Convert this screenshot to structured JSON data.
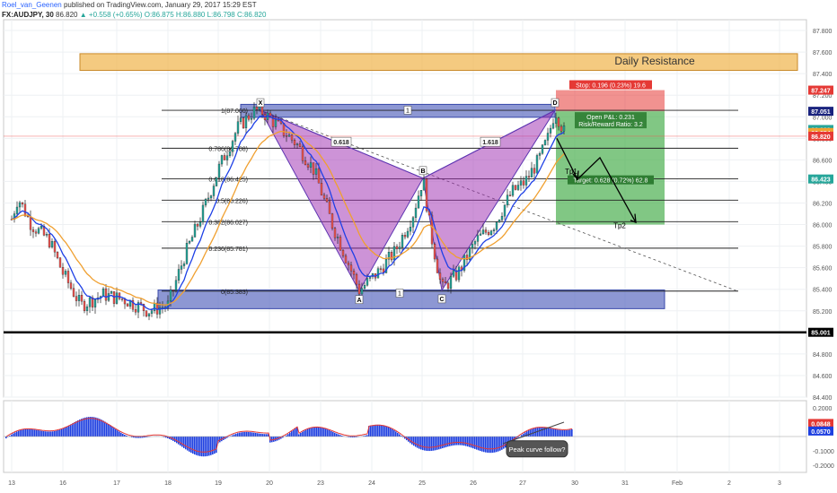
{
  "header": {
    "author": "Roel_van_Geenen",
    "published": "published on TradingView.com, January 29, 2017 15:29 EST",
    "symbol": "FX:AUDJPY, 30",
    "last": "86.820",
    "change_arrow": "▲",
    "change": "+0.558 (+0.65%)",
    "open": "O:86.875",
    "high": "H:86.880",
    "low": "L:86.798",
    "close": "C:86.820"
  },
  "colors": {
    "up": "#26a69a",
    "down": "#ef5350",
    "pattern": "#9c27b0",
    "zone": "#5c6bc0",
    "resistance": "#f0b34a",
    "target": "#4caf50",
    "stop": "#e53935",
    "ema_fast": "#1e40e6",
    "ema_slow": "#f0a030",
    "macd_hist": "#1e3fe0",
    "macd_signal": "#e53935"
  },
  "chart_data": [
    {
      "type": "candlestick",
      "instrument": "AUDJPY",
      "timeframe": "30",
      "x_ticks": [
        "13",
        "16",
        "17",
        "18",
        "19",
        "20",
        "23",
        "24",
        "25",
        "26",
        "27",
        "30",
        "31",
        "Feb",
        "2",
        "3"
      ],
      "price_ticks": [
        "87.800",
        "87.600",
        "87.400",
        "87.200",
        "87.000",
        "86.800",
        "86.600",
        "86.400",
        "86.200",
        "86.000",
        "85.800",
        "85.600",
        "85.400",
        "85.200",
        "85.000",
        "84.800",
        "84.600",
        "84.400"
      ],
      "ylim": [
        84.4,
        87.9
      ],
      "price_markers": [
        {
          "label": "87.247",
          "value": 87.247,
          "color": "#e53935"
        },
        {
          "label": "87.051",
          "value": 87.051,
          "color": "#1a237e"
        },
        {
          "label": "86.882",
          "value": 86.882,
          "color": "#26a69a"
        },
        {
          "label": "86.854",
          "value": 86.854,
          "color": "#f0a030"
        },
        {
          "label": "86.820",
          "value": 86.82,
          "color": "#e53935"
        },
        {
          "label": "86.423",
          "value": 86.423,
          "color": "#26a69a"
        },
        {
          "label": "85.001",
          "value": 85.001,
          "color": "#000000"
        }
      ],
      "fib_levels": [
        {
          "label": "1(87.060)",
          "value": 87.06
        },
        {
          "label": "0.786(86.708)",
          "value": 86.708
        },
        {
          "label": "0.618(86.425)",
          "value": 86.425
        },
        {
          "label": "0.5(86.226)",
          "value": 86.226
        },
        {
          "label": "0.382(86.027)",
          "value": 86.027
        },
        {
          "label": "0.236(85.781)",
          "value": 85.781
        },
        {
          "label": "0(85.383)",
          "value": 85.383
        }
      ],
      "pattern_points": [
        {
          "label": "X",
          "value": 87.06
        },
        {
          "label": "A",
          "value": 85.383
        },
        {
          "label": "B",
          "value": 86.43
        },
        {
          "label": "C",
          "value": 85.39
        },
        {
          "label": "D",
          "value": 87.06
        }
      ],
      "pattern_ratios": [
        "0.618",
        "1.618"
      ],
      "zone_labels": [
        "1",
        "1"
      ],
      "resistance_label": "Daily Resistance",
      "support_level": 85.001,
      "position": {
        "stop_label": "Stop: 0.196 (0.23%) 19.6",
        "pnl_label": "Open P&L: 0.231",
        "rr_label": "Risk/Reward Ratio: 3.2",
        "target_label": "Target: 0.628 (0.72%) 62.8",
        "entry": 87.051,
        "stop": 87.247,
        "target": 86.423
      },
      "take_profits": [
        "Tp1",
        "Tp2"
      ]
    },
    {
      "type": "bar",
      "indicator": "MACD",
      "ticks": [
        "0.2000",
        "0.1000",
        "-0.1000",
        "-0.2000"
      ],
      "ylim": [
        -0.25,
        0.25
      ],
      "value_labels": [
        "0.0848",
        "0.0570"
      ],
      "annotation": "Peak curve follow?"
    }
  ]
}
